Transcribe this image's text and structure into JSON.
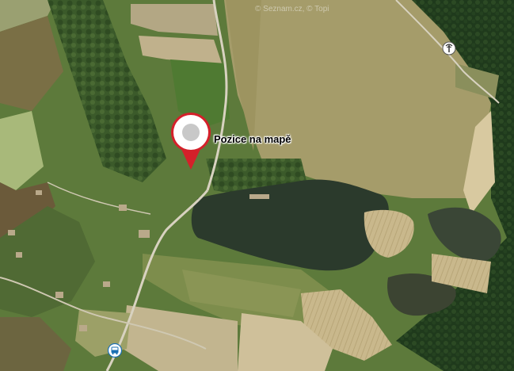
{
  "map": {
    "view": "aerial",
    "marker_label": "Pozice na mapě",
    "attribution": "© Seznam.cz, © Topi"
  },
  "icons": {
    "marker": "location-pin-icon",
    "bus_stop": "bus-stop-icon",
    "antenna": "antenna-icon"
  },
  "colors": {
    "marker": "#d4202a",
    "water": "#2d3a2b"
  }
}
